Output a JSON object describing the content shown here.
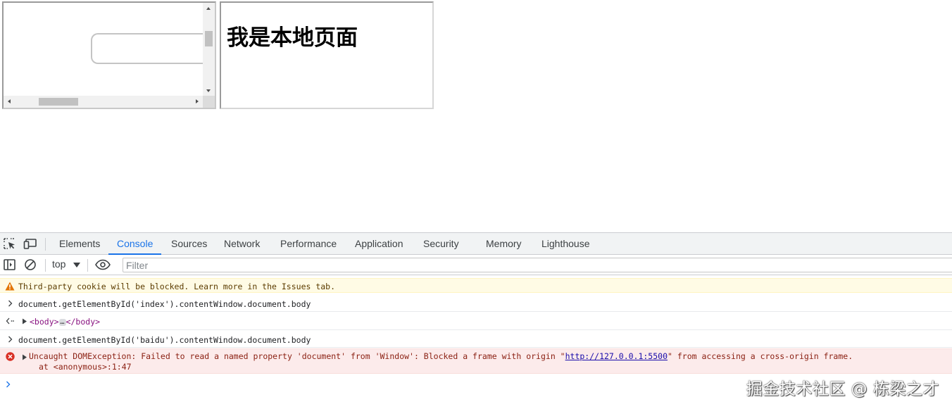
{
  "frames": {
    "local": {
      "heading": "我是本地页面"
    }
  },
  "devtools": {
    "tabs": [
      {
        "label": "Elements"
      },
      {
        "label": "Console",
        "active": true
      },
      {
        "label": "Sources"
      },
      {
        "label": "Network"
      },
      {
        "label": "Performance"
      },
      {
        "label": "Application"
      },
      {
        "label": "Security"
      },
      {
        "label": "Memory"
      },
      {
        "label": "Lighthouse"
      }
    ],
    "toolbar": {
      "context": "top",
      "filter_placeholder": "Filter"
    },
    "console": {
      "warning": "Third-party cookie will be blocked. Learn more in the Issues tab.",
      "input1": "document.getElementById('index').contentWindow.document.body",
      "output1": {
        "open_tag": "<body>",
        "ellipsis": "…",
        "close_tag": "</body>"
      },
      "input2": "document.getElementById('baidu').contentWindow.document.body",
      "error": {
        "text_before": "Uncaught DOMException: Failed to read a named property 'document' from 'Window': Blocked a frame with origin \"",
        "link": "http://127.0.0.1:5500",
        "text_after": "\" from accessing a cross-origin frame.",
        "stack": "at <anonymous>:1:47"
      }
    }
  },
  "watermark": "掘金技术社区 @ 栋梁之才",
  "colors": {
    "accent": "#1a73e8",
    "warning_bg": "#fffbe5",
    "error_bg": "#fcebeb",
    "error_icon": "#d93025",
    "warning_icon": "#e37400"
  }
}
